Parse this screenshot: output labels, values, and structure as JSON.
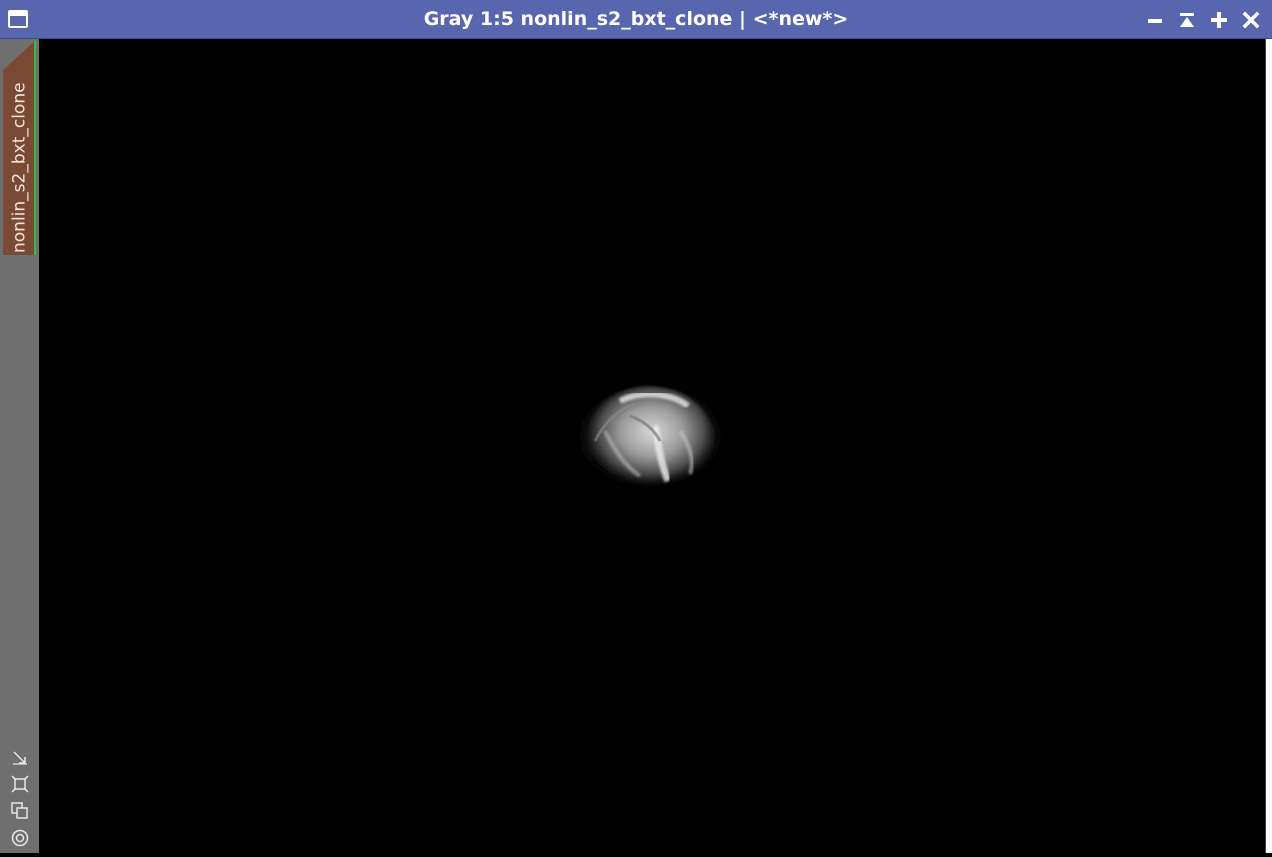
{
  "window": {
    "title": "Gray 1:5 nonlin_s2_bxt_clone | <*new*>",
    "controls": [
      "minimize",
      "shade",
      "maximize",
      "close"
    ]
  },
  "sidebar": {
    "view_tab_label": "nonlin_s2_bxt_clone",
    "tools": [
      "zoom-to-fit-icon",
      "fit-view-icon",
      "clone-icon",
      "target-icon"
    ]
  },
  "colors": {
    "titlebar": "#5866b0",
    "sidebar": "#6f6f6f",
    "view_tab": "#7b4a34",
    "tab_accent": "#27c04a",
    "canvas": "#000000"
  }
}
